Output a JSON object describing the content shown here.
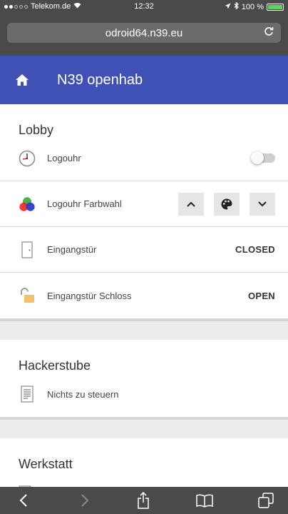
{
  "status": {
    "carrier": "Telekom.de",
    "time": "12:32",
    "battery": "100 %"
  },
  "browser": {
    "url": "odroid64.n39.eu"
  },
  "app": {
    "title": "N39 openhab"
  },
  "sections": [
    {
      "title": "Lobby",
      "items": [
        {
          "label": "Logouhr",
          "icon": "clock-icon",
          "control": "switch",
          "state": "off"
        },
        {
          "label": "Logouhr Farbwahl",
          "icon": "color-circles-icon",
          "control": "color-buttons"
        },
        {
          "label": "Eingangstür",
          "icon": "door-icon",
          "value": "CLOSED"
        },
        {
          "label": "Eingangstür Schloss",
          "icon": "lock-open-icon",
          "value": "OPEN"
        }
      ]
    },
    {
      "title": "Hackerstube",
      "items": [
        {
          "label": "Nichts zu steuern",
          "icon": "document-icon"
        }
      ]
    },
    {
      "title": "Werkstatt",
      "items": []
    }
  ],
  "colors": {
    "appbar": "#3f51b5",
    "browser_chrome": "#4a4a4a",
    "page_bg": "#ececec"
  }
}
